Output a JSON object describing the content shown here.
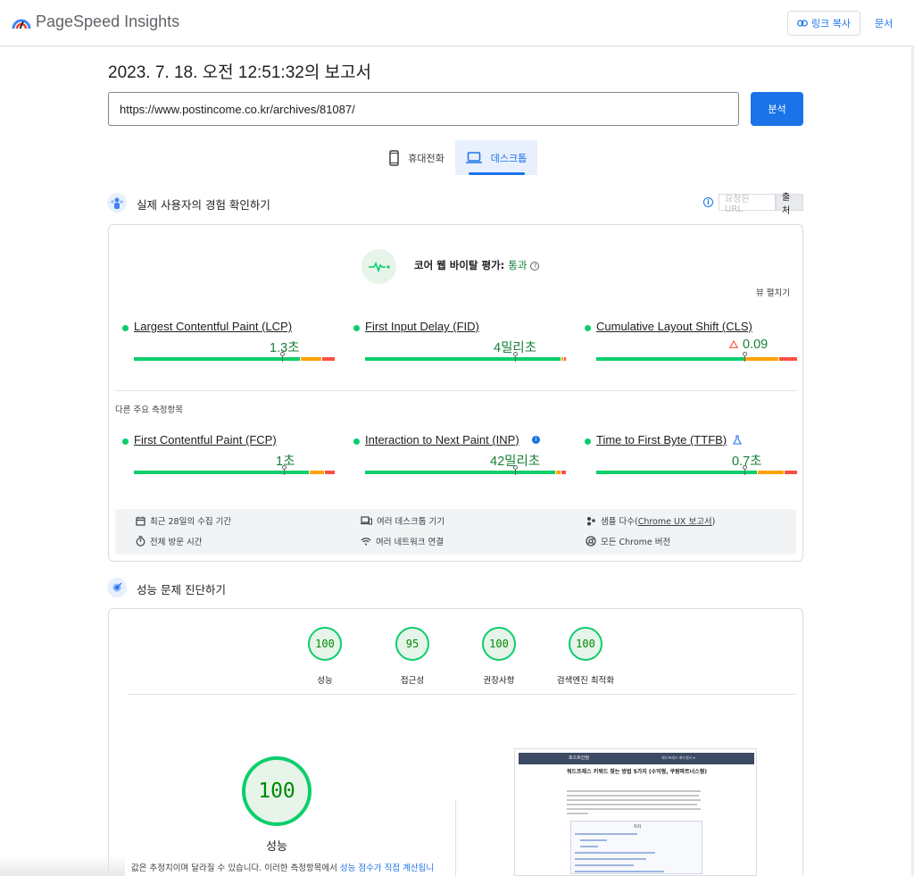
{
  "app": {
    "title": "PageSpeed Insights"
  },
  "header": {
    "copy_link": "링크 복사",
    "docs": "문서"
  },
  "report": {
    "title": "2023. 7. 18. 오전 12:51:32의 보고서",
    "url_value": "https://www.postincome.co.kr/archives/81087/",
    "analyze_button": "분석"
  },
  "tabs": [
    {
      "label": "휴대전화",
      "icon": "smartphone-icon",
      "selected": false
    },
    {
      "label": "데스크톱",
      "icon": "laptop-icon",
      "selected": true
    }
  ],
  "field_data": {
    "section_title": "실제 사용자의 경험 확인하기",
    "toggle": {
      "url": "요청된 URL",
      "origin": "출처",
      "selected": "출처"
    },
    "assessment": {
      "label": "코어 웹 바이탈 평가: ",
      "status": "통과"
    },
    "expand_view": "뷰 펼치기",
    "core_metrics": [
      {
        "name": "Largest Contentful Paint (LCP)",
        "value": "1.3초",
        "status": "good",
        "distribution": [
          0.84,
          0.1,
          0.06
        ],
        "marker": 0.74
      },
      {
        "name": "First Input Delay (FID)",
        "value": "4밀리초",
        "status": "good",
        "distribution": [
          0.98,
          0.01,
          0.01
        ],
        "marker": 0.75
      },
      {
        "name": "Cumulative Layout Shift (CLS)",
        "value": "0.09",
        "status": "good",
        "warning": true,
        "distribution": [
          0.74,
          0.17,
          0.09
        ],
        "marker": 0.74
      }
    ],
    "other_label": "다른 주요 측정항목",
    "other_metrics": [
      {
        "name": "First Contentful Paint (FCP)",
        "value": "1초",
        "status": "good",
        "distribution": [
          0.88,
          0.07,
          0.05
        ],
        "marker": 0.75,
        "suffix_icon": ""
      },
      {
        "name": "Interaction to Next Paint (INP)",
        "value": "42밀리초",
        "status": "good",
        "distribution": [
          0.96,
          0.02,
          0.02
        ],
        "marker": 0.75,
        "suffix_icon": "info-icon"
      },
      {
        "name": "Time to First Byte (TTFB)",
        "value": "0.7초",
        "status": "good",
        "distribution": [
          0.81,
          0.13,
          0.06
        ],
        "marker": 0.74,
        "suffix_icon": "flask-icon"
      }
    ],
    "info": {
      "collection_period": "최근 28일의 수집 기간",
      "visit_duration": "전체 방문 시간",
      "devices": "여러 데스크톱 기기",
      "network": "여러 네트워크 연결",
      "samples_prefix": "샘플 다수(",
      "samples_link": "Chrome UX 보고서",
      "samples_suffix": ")",
      "chrome_versions": "모든 Chrome 버전"
    }
  },
  "diagnostics": {
    "section_title": "성능 문제 진단하기",
    "categories": [
      {
        "score": "100",
        "label": "성능"
      },
      {
        "score": "95",
        "label": "접근성"
      },
      {
        "score": "100",
        "label": "권장사항"
      },
      {
        "score": "100",
        "label": "검색엔진 최적화"
      }
    ],
    "main_score": "100",
    "main_label": "성능",
    "disclaimer_text": "값은 추정치이며 달라질 수 있습니다. 이러한 측정항목에서 ",
    "disclaimer_link": "성능 점수가 직접 계산됩니"
  },
  "screenshot": {
    "brand": "포스트인컴",
    "nav": "워드프레스   애드센스  ▾",
    "title": "워드프레스 키워드 찾는 방법 5가지 (수익형, 쿠팡파트너스형)",
    "toc_title": "목차"
  },
  "colors": {
    "accent": "#1a73e8",
    "good": "#0cce6b",
    "average": "#ffa400",
    "poor": "#ff4e42",
    "good_text": "#188038"
  }
}
